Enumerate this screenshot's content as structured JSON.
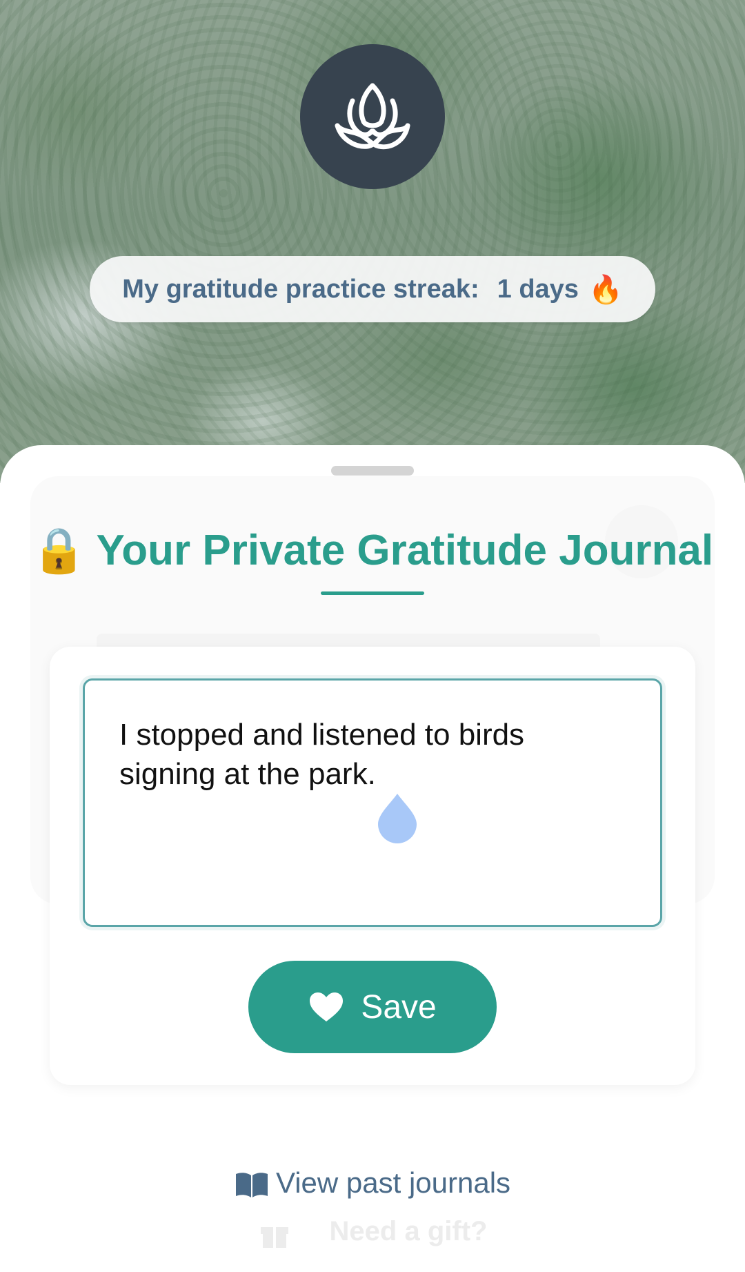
{
  "header": {
    "logo_icon": "lotus-icon",
    "streak": {
      "label": "My gratitude practice streak:",
      "value": "1 days",
      "emoji": "🔥"
    }
  },
  "journal": {
    "lock_emoji": "🔒",
    "title": "Your Private Gratitude Journal",
    "entry_text": "I stopped and listened to birds signing at the park.",
    "save_label": "Save",
    "save_icon": "heart-icon"
  },
  "footer": {
    "past_journals_label": "View past journals",
    "past_journals_icon": "book-icon",
    "gift_label": "Need a gift?",
    "gift_icon": "gift-icon"
  },
  "colors": {
    "accent": "#2a9d8c",
    "logo_bg": "#37434f",
    "link": "#4a6a88",
    "input_border": "#5aa5a8",
    "cursor_handle": "#a8c8f8"
  }
}
